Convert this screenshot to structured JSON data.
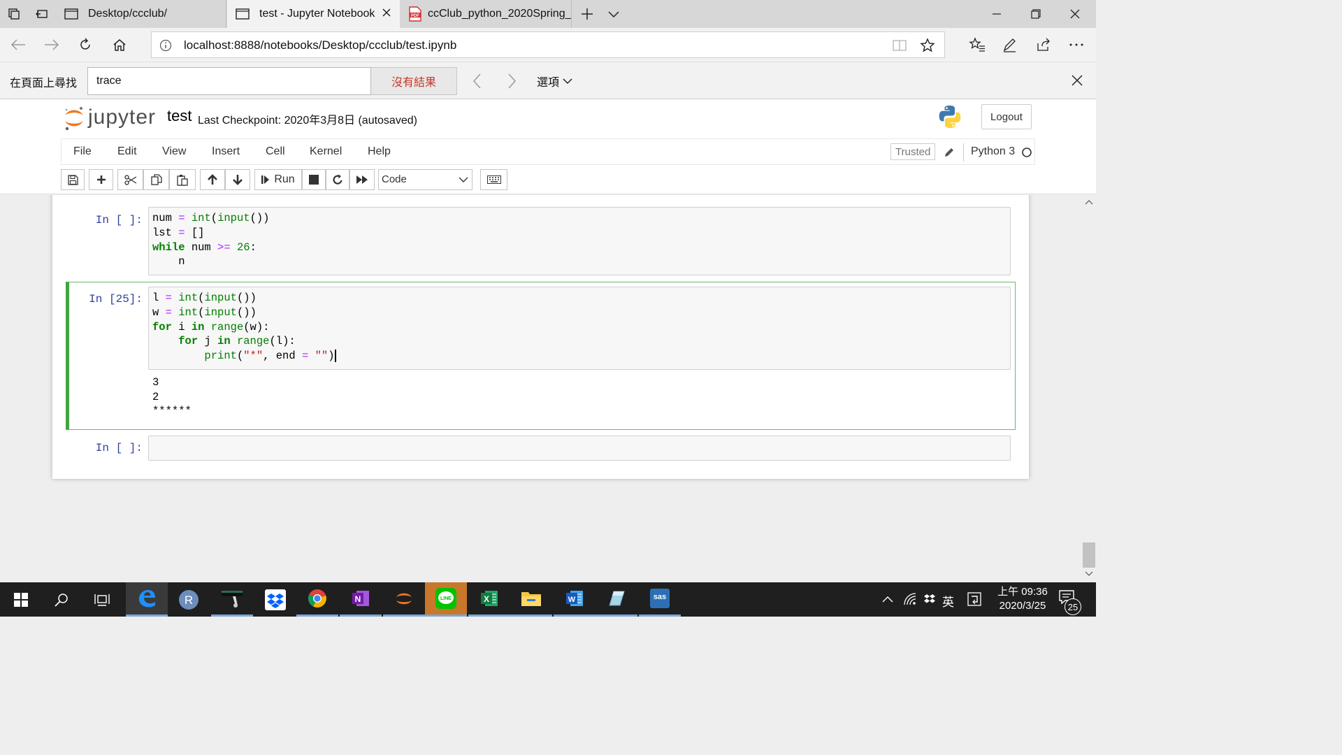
{
  "browser": {
    "tabs": [
      {
        "title": "Desktop/ccclub/",
        "icon": "page-icon"
      },
      {
        "title": "test - Jupyter Notebook",
        "icon": "page-icon"
      },
      {
        "title": "ccClub_python_2020Spring_",
        "icon": "pdf-icon"
      }
    ],
    "pdf_badge": "PDF",
    "url": "localhost:8888/notebooks/Desktop/ccclub/test.ipynb"
  },
  "findbar": {
    "label": "在頁面上尋找",
    "query": "trace",
    "result": "沒有結果",
    "options_label": "選項"
  },
  "jupyter": {
    "logo_text": "jupyter",
    "notebook_title": "test",
    "checkpoint_text": "Last Checkpoint: 2020年3月8日   (autosaved)",
    "logout_label": "Logout",
    "menu": [
      "File",
      "Edit",
      "View",
      "Insert",
      "Cell",
      "Kernel",
      "Help"
    ],
    "trusted_label": "Trusted",
    "kernel_label": "Python 3",
    "run_label": "Run",
    "cell_type": "Code"
  },
  "cells": [
    {
      "prompt": "In [ ]:"
    },
    {
      "prompt": "In [25]:",
      "output": [
        "3",
        "2",
        "******"
      ]
    },
    {
      "prompt": "In [ ]:"
    }
  ],
  "taskbar": {
    "r_label": "R",
    "onenote_label": "N",
    "line_label": "LINE",
    "excel_label": "X",
    "word_label": "W",
    "sas_label": "sas",
    "ime_label": "英",
    "time": "上午 09:36",
    "date": "2020/3/25",
    "notification_count": "25"
  },
  "colors": {
    "selected_cell_border": "#42a541",
    "prompt_color": "#303f9f",
    "keyword_color": "#008000",
    "operator_color": "#aa22ff",
    "string_color": "#ba2121",
    "find_result_color": "#c0392b"
  }
}
